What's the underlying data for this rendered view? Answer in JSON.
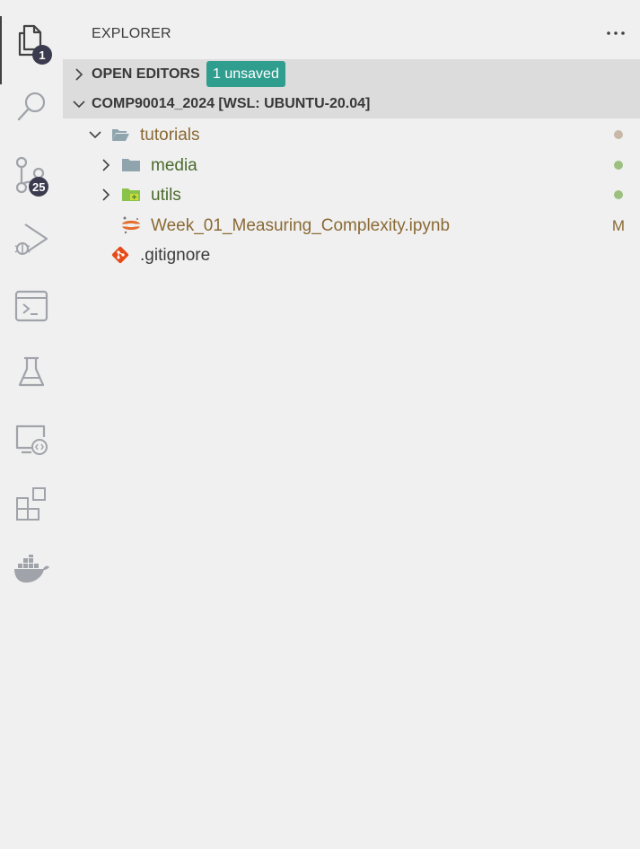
{
  "activity_bar": {
    "explorer_badge": "1",
    "source_control_badge": "25",
    "icons": [
      "files-icon",
      "search-icon",
      "source-control-icon",
      "run-debug-icon",
      "terminal-icon",
      "testing-icon",
      "remote-explorer-icon",
      "extensions-icon",
      "docker-icon"
    ]
  },
  "sidebar": {
    "title": "EXPLORER",
    "more_label": "···",
    "open_editors": {
      "label": "OPEN EDITORS",
      "badge": "1 unsaved"
    },
    "workspace": {
      "label": "COMP90014_2024 [WSL: UBUNTU-20.04]"
    }
  },
  "tree": [
    {
      "name": "tutorials",
      "kind": "folder-open",
      "color": "#8a6a35",
      "status": "dot",
      "status_color": "#c8b8a8"
    },
    {
      "name": "media",
      "kind": "folder",
      "color": "#4b6b2e",
      "status": "dot",
      "status_color": "#9bc07f"
    },
    {
      "name": "utils",
      "kind": "folder-utils",
      "color": "#4b6b2e",
      "status": "dot",
      "status_color": "#9bc07f"
    },
    {
      "name": "Week_01_Measuring_Complexity.ipynb",
      "kind": "jupyter",
      "color": "#8a6a35",
      "status": "M",
      "status_color": "#8a6a35"
    },
    {
      "name": ".gitignore",
      "kind": "git",
      "color": "#3b3b3b"
    }
  ],
  "colors": {
    "background": "#f0f0f0",
    "header_bg": "#dcdcdc",
    "badge_bg": "#2f9e8f",
    "activity_icon": "#a0a4aa",
    "activity_badge": "#3b3b4f"
  }
}
